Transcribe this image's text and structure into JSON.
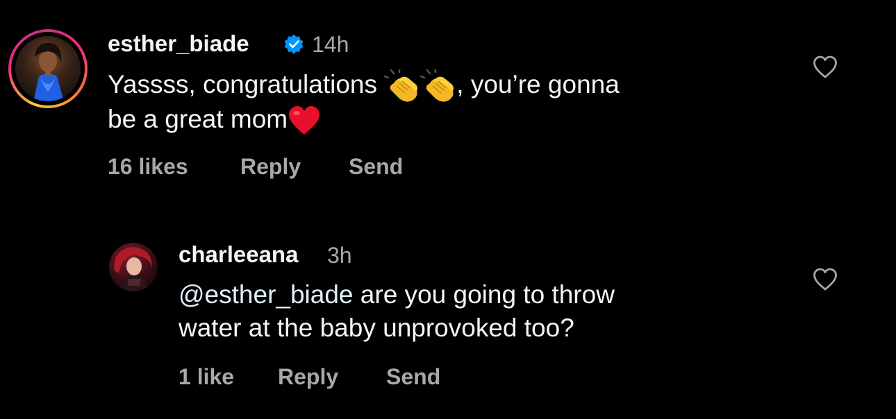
{
  "comments": [
    {
      "username": "esther_biade",
      "verified": true,
      "time": "14h",
      "text_line1_a": "Yassss, congratulations",
      "text_line1_b": ", you’re gonna",
      "text_line2": "be a great mom",
      "emojis": [
        "clapping-hands",
        "clapping-hands",
        "red-heart"
      ],
      "likes": "16 likes",
      "reply": "Reply",
      "send": "Send"
    },
    {
      "username": "charleeana",
      "verified": false,
      "time": "3h",
      "mention": "@esther_biade",
      "text_line1": " are you going to throw",
      "text_line2": "water at the baby unprovoked too?",
      "likes": "1 like",
      "reply": "Reply",
      "send": "Send"
    }
  ],
  "colors": {
    "background": "#000000",
    "primary_text": "#f5f5f5",
    "secondary_text": "#a8a8a8",
    "verified_blue": "#0095f6",
    "mention": "#e0f1ff",
    "heart_red": "#e8102a"
  },
  "icons": {
    "like": "heart-outline-icon",
    "verified": "verified-badge-icon"
  }
}
